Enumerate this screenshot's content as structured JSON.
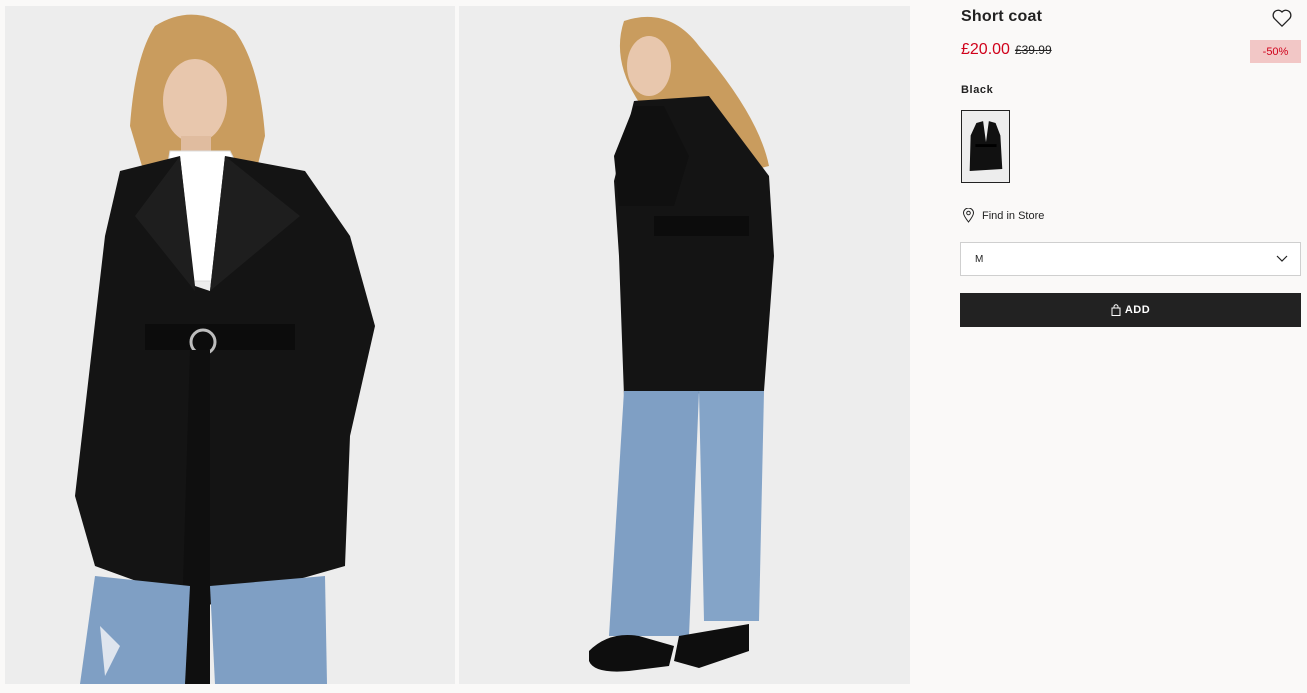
{
  "product": {
    "title": "Short coat",
    "price_now": "£20.00",
    "price_old": "£39.99",
    "discount_badge": "-50%",
    "color_label": "Black"
  },
  "store": {
    "find_label": "Find in Store"
  },
  "size_select": {
    "selected": "M"
  },
  "cart": {
    "add_label": "ADD"
  },
  "gallery": {
    "images": [
      "front-view-model-photo",
      "side-view-model-photo"
    ]
  },
  "icons": {
    "favorite": "heart-outline-icon",
    "location": "map-pin-icon",
    "dropdown": "chevron-down-icon",
    "bag": "shopping-bag-icon"
  },
  "colors": {
    "sale_red": "#d0021b",
    "badge_bg": "#f2c7c6",
    "button_bg": "#222222",
    "page_bg": "#faf9f8"
  }
}
